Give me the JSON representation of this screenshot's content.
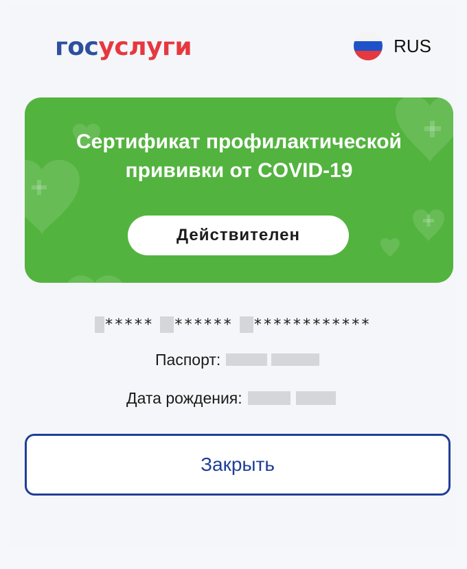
{
  "colors": {
    "brand_blue": "#2d4f9e",
    "brand_red": "#e5383f",
    "brand_blue_dark": "#1f3e98",
    "card_green": "#53b33f"
  },
  "header": {
    "logo_part1": "гос",
    "logo_part2": "услуги",
    "language_label": "RUS",
    "language_flag_icon": "russia-flag-icon"
  },
  "certificate": {
    "title_line1": "Сертификат профилактической",
    "title_line2": "прививки от COVID-19",
    "status": "Действителен"
  },
  "person": {
    "name_masks": [
      "*****",
      "******",
      "************"
    ],
    "passport_label": "Паспорт:",
    "birthdate_label": "Дата рождения:"
  },
  "actions": {
    "close_label": "Закрыть"
  }
}
